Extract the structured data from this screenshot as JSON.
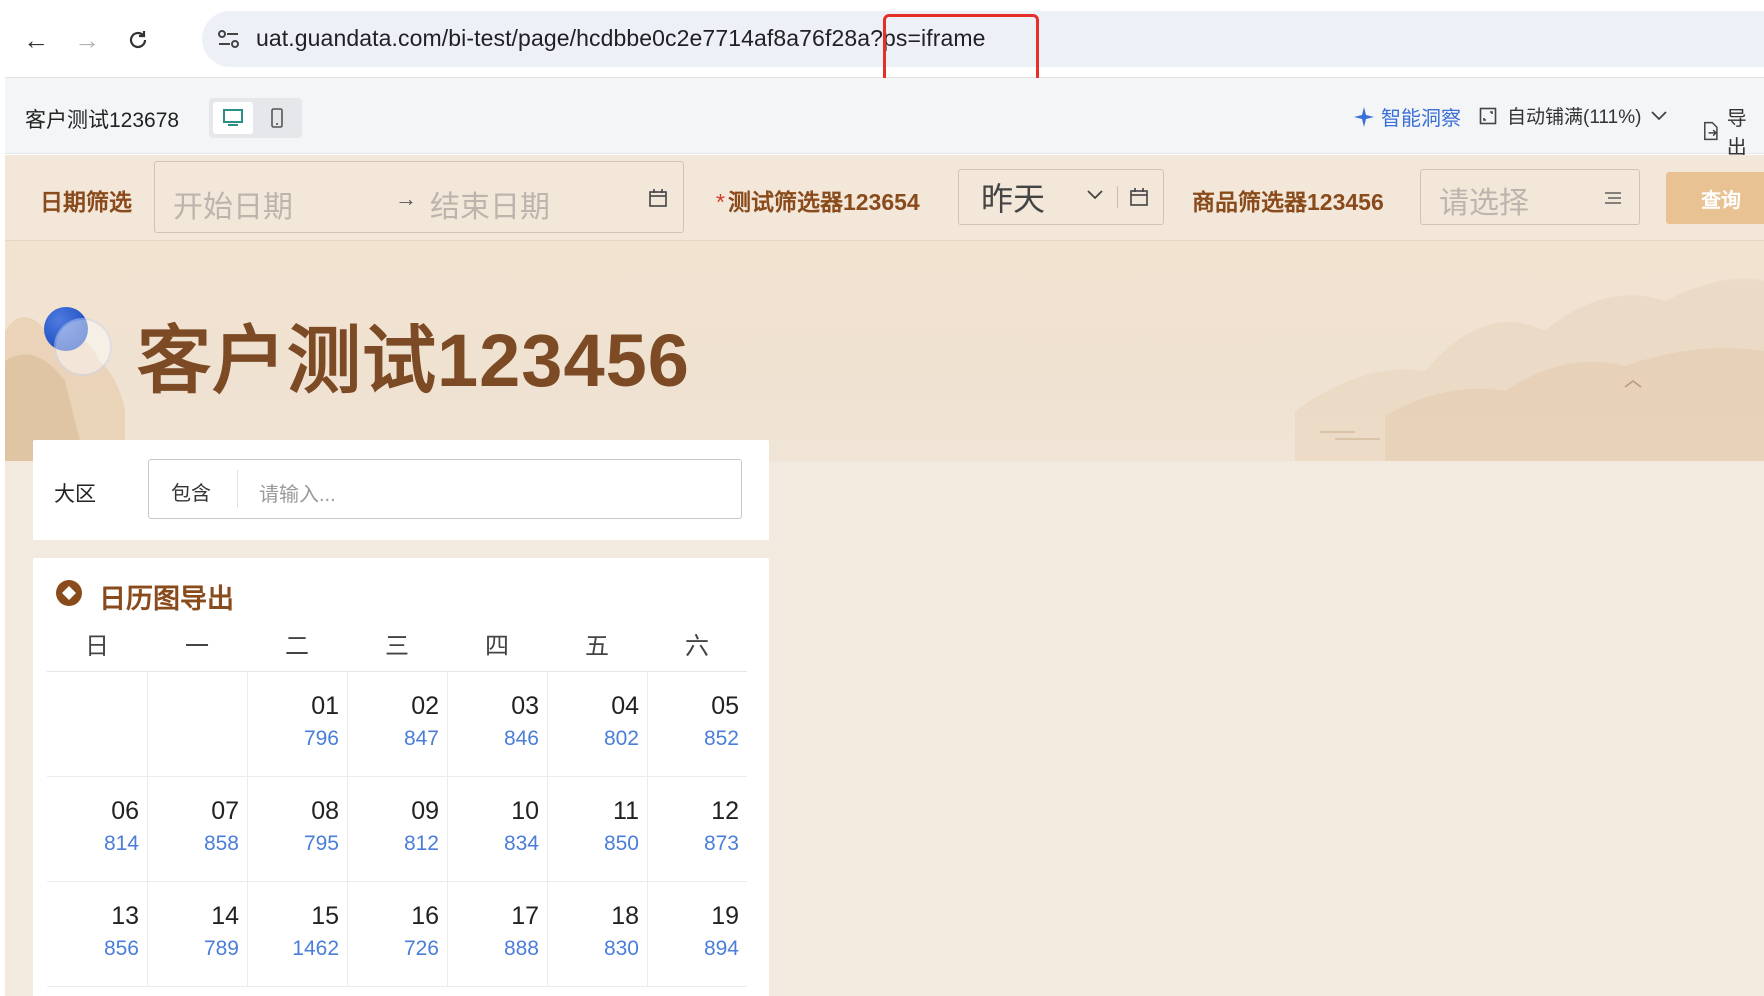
{
  "browser": {
    "url": "uat.guandata.com/bi-test/page/hcdbbe0c2e7714af8a76f28a?ps=iframe"
  },
  "toolbar": {
    "page_name": "客户测试123678",
    "ai_insight": "智能洞察",
    "zoom_label": "自动铺满(111%)",
    "export_label": "导出"
  },
  "filters": {
    "date_label": "日期筛选",
    "start_placeholder": "开始日期",
    "end_placeholder": "结束日期",
    "test_filter_label": "测试筛选器123654",
    "test_filter_value": "昨天",
    "product_filter_label": "商品筛选器123456",
    "product_placeholder": "请选择",
    "query_button": "查询"
  },
  "page": {
    "title": "客户测试123456"
  },
  "region_filter": {
    "label": "大区",
    "operator": "包含",
    "placeholder": "请输入..."
  },
  "calendar": {
    "title": "日历图导出",
    "weekdays": [
      "日",
      "一",
      "二",
      "三",
      "四",
      "五",
      "六"
    ],
    "weeks": [
      [
        null,
        null,
        {
          "day": "01",
          "value": "796"
        },
        {
          "day": "02",
          "value": "847"
        },
        {
          "day": "03",
          "value": "846"
        },
        {
          "day": "04",
          "value": "802"
        },
        {
          "day": "05",
          "value": "852"
        }
      ],
      [
        {
          "day": "06",
          "value": "814"
        },
        {
          "day": "07",
          "value": "858"
        },
        {
          "day": "08",
          "value": "795"
        },
        {
          "day": "09",
          "value": "812"
        },
        {
          "day": "10",
          "value": "834"
        },
        {
          "day": "11",
          "value": "850"
        },
        {
          "day": "12",
          "value": "873"
        }
      ],
      [
        {
          "day": "13",
          "value": "856"
        },
        {
          "day": "14",
          "value": "789"
        },
        {
          "day": "15",
          "value": "1462"
        },
        {
          "day": "16",
          "value": "726"
        },
        {
          "day": "17",
          "value": "888"
        },
        {
          "day": "18",
          "value": "830"
        },
        {
          "day": "19",
          "value": "894"
        }
      ]
    ]
  },
  "colors": {
    "accent_brown": "#8a4b1c",
    "value_blue": "#4a7ed9",
    "query_button": "#e8c292",
    "highlight_red": "#e5302a"
  }
}
